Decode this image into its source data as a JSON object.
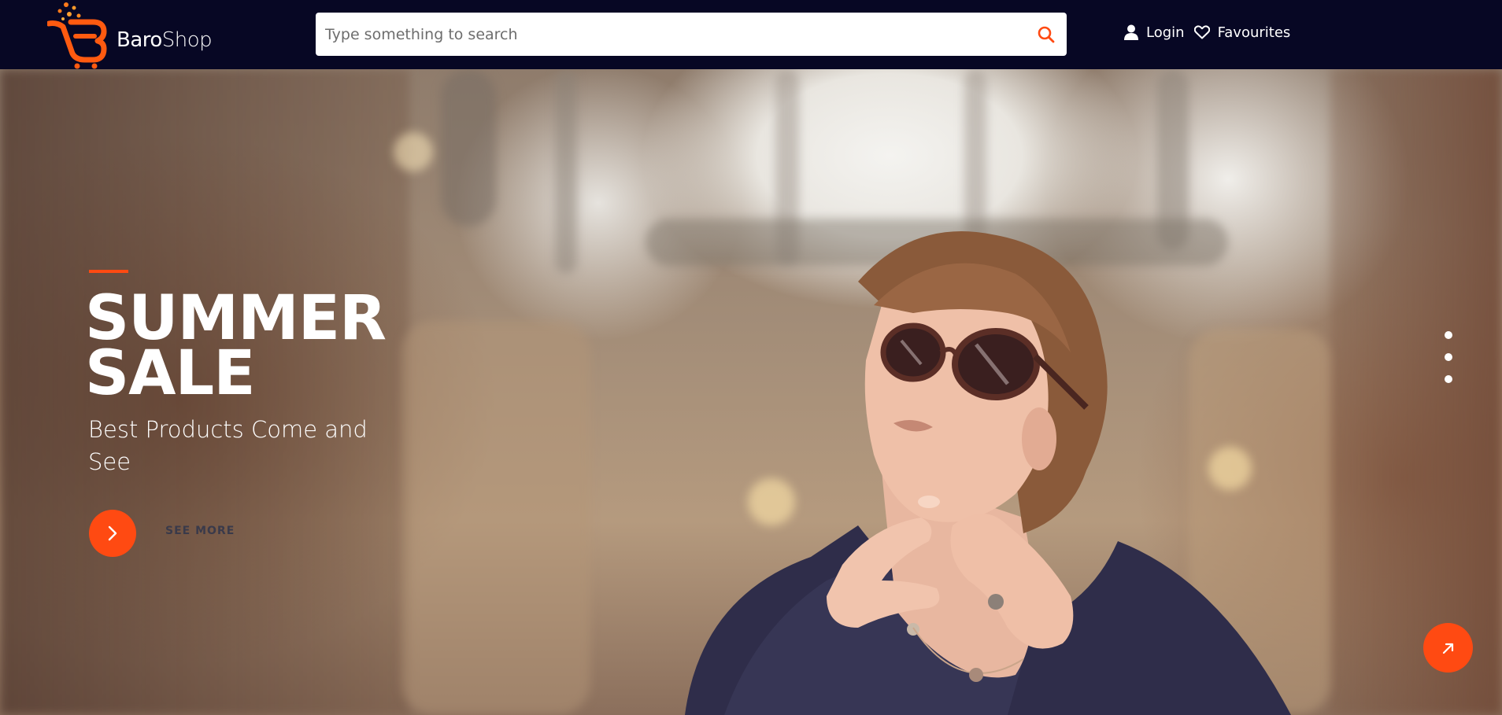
{
  "brand": {
    "name_part1": "Baro",
    "name_part2": "Shop",
    "accent": "#ff4a12",
    "header_bg": "#070724"
  },
  "search": {
    "placeholder": "Type something to search",
    "value": ""
  },
  "nav": {
    "login_label": "Login",
    "favourites_label": "Favourites"
  },
  "hero": {
    "title_line1": "SUMMER",
    "title_line2": "SALE",
    "subtitle": "Best Products Come and See",
    "cta_label": "SEE MORE",
    "slide_count": 3
  },
  "icons": {
    "logo": "cart-logo-icon",
    "search": "search-icon",
    "login": "user-icon",
    "favourites": "heart-icon",
    "cta": "chevron-right-icon",
    "fab": "arrow-up-right-icon"
  }
}
